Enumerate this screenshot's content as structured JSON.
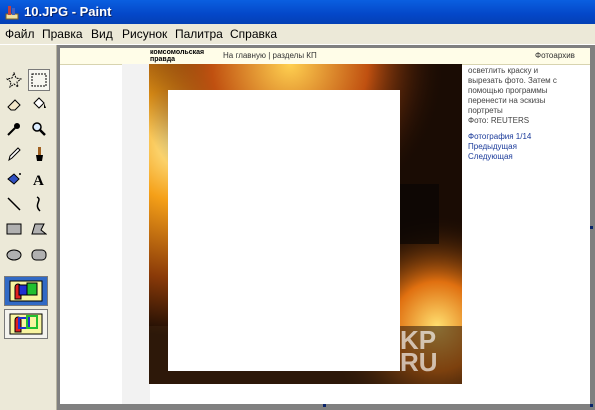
{
  "window": {
    "title": "10.JPG - Paint"
  },
  "menu": {
    "items": [
      "Файл",
      "Правка",
      "Вид",
      "Рисунок",
      "Палитра",
      "Справка"
    ]
  },
  "tools": [
    "free-select-icon",
    "rect-select-icon",
    "eraser-icon",
    "fill-icon",
    "color-picker-icon",
    "magnifier-icon",
    "pencil-icon",
    "brush-icon",
    "airbrush-icon",
    "text-icon",
    "line-icon",
    "curve-icon",
    "rectangle-icon",
    "polygon-icon",
    "ellipse-icon",
    "rounded-rect-icon"
  ],
  "webpage": {
    "logo": "комсомольская правда",
    "nav_text": "На главную | разделы КП",
    "header_right": "Фотоархив",
    "side_text": "осветлить краску и вырезать фото. Затем с помощью программы перенести на эскизы портреты",
    "side_credit": "Фото: REUTERS",
    "side_link1": "Фотография 1/14",
    "side_link2": "Предыдущая",
    "side_link3": "Следующая",
    "watermark_top": "KP",
    "watermark_bottom": "RU"
  },
  "colors": {
    "titlebar": "#0447c8",
    "fire": "#f2a21c",
    "canvas_bg": "#808080"
  }
}
